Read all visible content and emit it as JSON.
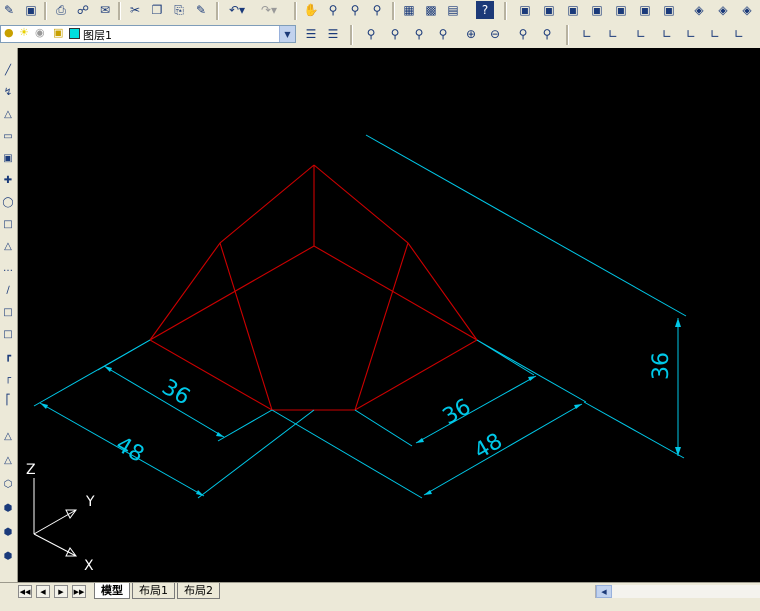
{
  "toolbar_layers": {
    "current_layer": "图层1"
  },
  "layout_tabs": [
    {
      "label": "模型",
      "active": true
    },
    {
      "label": "布局1",
      "active": false
    },
    {
      "label": "布局2",
      "active": false
    }
  ],
  "ucs": {
    "z_label": "Z",
    "y_label": "Y",
    "x_label": "X"
  },
  "dimensions": {
    "left_inner": "36",
    "left_outer": "48",
    "right_inner": "36",
    "right_outer": "48",
    "height": "36"
  },
  "colors": {
    "canvas": "#000000",
    "geometry": "#cc0000",
    "dimension": "#00c8e8",
    "ucs": "#ffffff"
  },
  "icons": {
    "standard": [
      "new-icon",
      "save-icon",
      "print-icon",
      "print-preview-icon",
      "publish-icon",
      "cut-icon",
      "copy-icon",
      "paste-icon",
      "match-properties-icon",
      "undo-icon",
      "redo-icon",
      "pan-icon",
      "zoom-realtime-icon",
      "zoom-window-icon",
      "zoom-previous-icon",
      "properties-icon",
      "design-center-icon",
      "tool-palettes-icon",
      "help-icon",
      "view-top-icon",
      "view-bottom-icon",
      "view-left-icon",
      "view-right-icon",
      "view-front-icon",
      "view-back-icon",
      "view-sw-iso-icon",
      "view-se-iso-icon",
      "view-ne-iso-icon"
    ],
    "zoom": [
      "zoom-window-icon",
      "zoom-dynamic-icon",
      "zoom-scale-icon",
      "zoom-center-icon",
      "zoom-in-icon",
      "zoom-out-icon",
      "zoom-all-icon",
      "zoom-extents-icon"
    ],
    "ucs": [
      "ucs-icon",
      "ucs-world-icon",
      "ucs-previous-icon",
      "ucs-face-icon",
      "ucs-object-icon",
      "ucs-view-icon",
      "ucs-origin-icon"
    ],
    "draw": [
      "line-icon",
      "construction-line-icon",
      "polyline-icon",
      "polygon-icon",
      "rectangle-icon",
      "arc-icon",
      "circle-icon",
      "revision-cloud-icon",
      "spline-icon",
      "ellipse-icon",
      "block-icon",
      "point-icon",
      "hatch-icon",
      "region-icon",
      "table-icon",
      "text-icon",
      "box-icon",
      "sphere-icon",
      "cylinder-icon",
      "cone-icon",
      "wedge-icon",
      "torus-icon"
    ]
  }
}
